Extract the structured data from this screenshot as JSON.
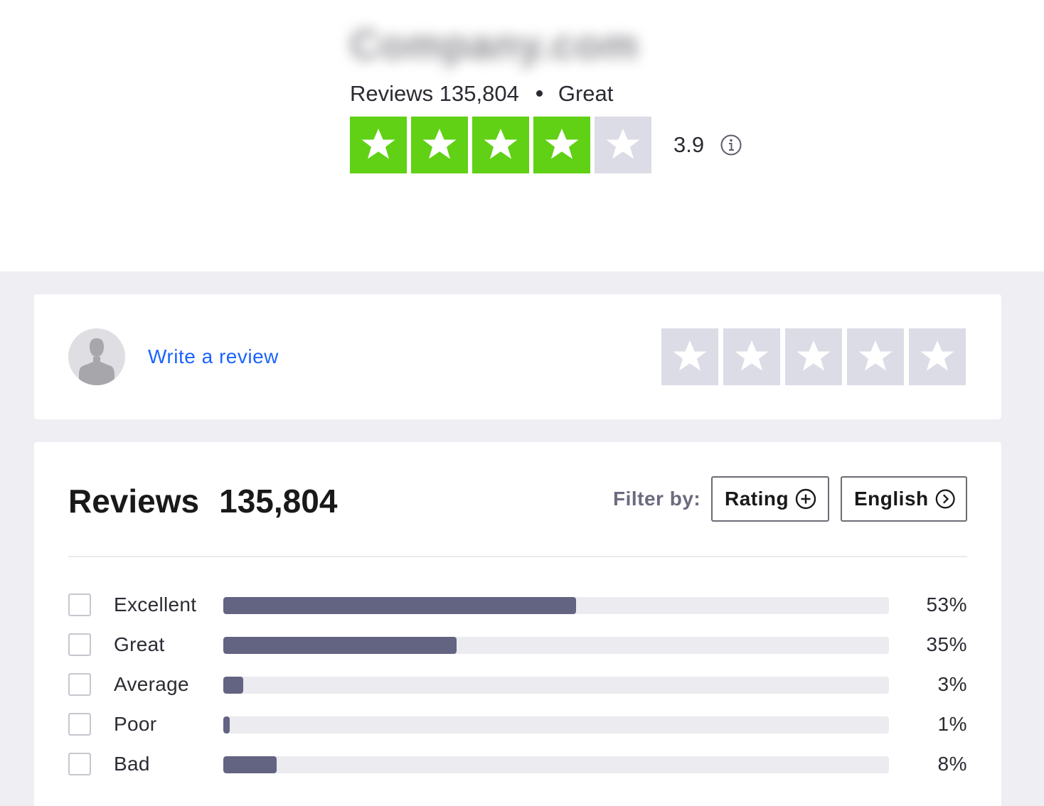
{
  "header": {
    "company_name": "Company.com",
    "reviews_label": "Reviews",
    "reviews_count": "135,804",
    "rating_word": "Great",
    "score": "3.9",
    "star_rating": 3.9,
    "stars_filled": 4,
    "stars_total": 5
  },
  "write_review": {
    "link_label": "Write a review",
    "stars_total": 5
  },
  "reviews": {
    "title": "Reviews",
    "count": "135,804",
    "filter_label": "Filter by:",
    "filters": [
      {
        "label": "Rating",
        "icon": "plus-circle-icon"
      },
      {
        "label": "English",
        "icon": "chevron-right-circle-icon"
      }
    ],
    "distribution": [
      {
        "label": "Excellent",
        "percent_text": "53%",
        "percent": 53
      },
      {
        "label": "Great",
        "percent_text": "35%",
        "percent": 35
      },
      {
        "label": "Average",
        "percent_text": "3%",
        "percent": 3
      },
      {
        "label": "Poor",
        "percent_text": "1%",
        "percent": 1
      },
      {
        "label": "Bad",
        "percent_text": "8%",
        "percent": 8
      }
    ]
  },
  "colors": {
    "star_green": "#60d114",
    "star_grey": "#dcdce6",
    "link_blue": "#1c63ff",
    "bar_fill": "#636382",
    "bar_track": "#ebebf0"
  }
}
